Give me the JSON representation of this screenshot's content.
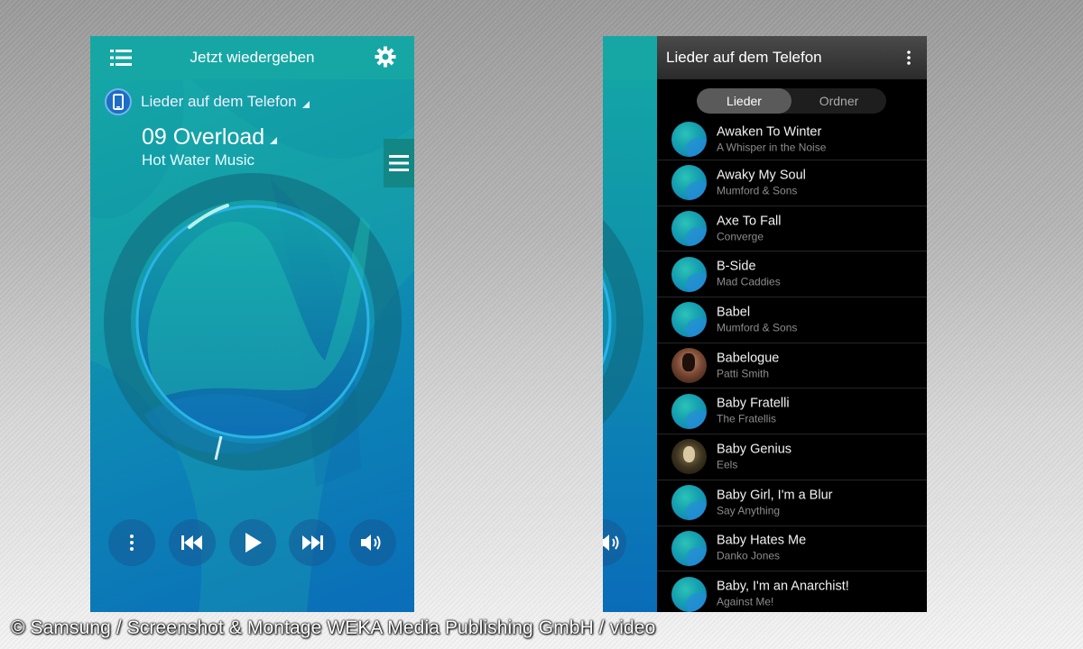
{
  "player": {
    "header_title": "Jetzt wiedergeben",
    "source_label": "Lieder auf dem Telefon",
    "track_title": "09 Overload",
    "track_artist": "Hot Water Music",
    "icons": [
      "list-menu-icon",
      "gear-icon",
      "phone-icon",
      "hamburger-icon",
      "more-vertical-icon",
      "skip-previous-icon",
      "play-icon",
      "skip-next-icon",
      "volume-icon"
    ],
    "accent_color": "#16a7a5"
  },
  "library": {
    "header_title": "Lieder auf dem Telefon",
    "tabs": [
      {
        "label": "Lieder",
        "active": true
      },
      {
        "label": "Ordner",
        "active": false
      }
    ],
    "songs": [
      {
        "title": "Awaken To Winter",
        "artist": "A Whisper in the Noise"
      },
      {
        "title": "Awaky My Soul",
        "artist": "Mumford & Sons"
      },
      {
        "title": "Axe To Fall",
        "artist": "Converge"
      },
      {
        "title": "B-Side",
        "artist": "Mad Caddies"
      },
      {
        "title": "Babel",
        "artist": "Mumford & Sons"
      },
      {
        "title": "Babelogue",
        "artist": "Patti Smith"
      },
      {
        "title": "Baby Fratelli",
        "artist": "The Fratellis"
      },
      {
        "title": "Baby Genius",
        "artist": "Eels"
      },
      {
        "title": "Baby Girl, I'm a Blur",
        "artist": "Say Anything"
      },
      {
        "title": "Baby Hates Me",
        "artist": "Danko Jones"
      },
      {
        "title": "Baby, I'm an Anarchist!",
        "artist": "Against Me!"
      }
    ]
  },
  "credit": "© Samsung / Screenshot & Montage WEKA Media Publishing GmbH / video"
}
